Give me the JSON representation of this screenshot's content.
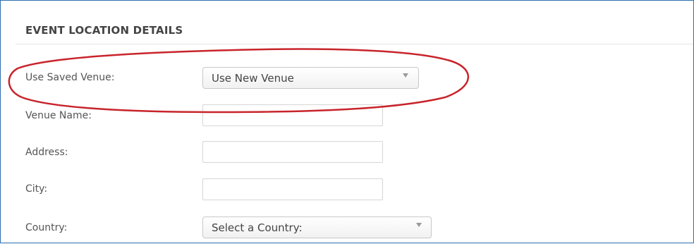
{
  "section": {
    "title": "EVENT LOCATION DETAILS"
  },
  "fields": {
    "saved_venue": {
      "label": "Use Saved Venue:",
      "selected": "Use New Venue"
    },
    "venue_name": {
      "label": "Venue Name:",
      "value": ""
    },
    "address": {
      "label": "Address:",
      "value": ""
    },
    "city": {
      "label": "City:",
      "value": ""
    },
    "country": {
      "label": "Country:",
      "selected": "Select a Country:"
    }
  },
  "colors": {
    "frame_border": "#2f6fb0",
    "annotation_ellipse": "#c8242b",
    "label_text": "#555555",
    "caret": "#999999"
  },
  "icons": {
    "dropdown_caret": "chevron-down-icon"
  }
}
